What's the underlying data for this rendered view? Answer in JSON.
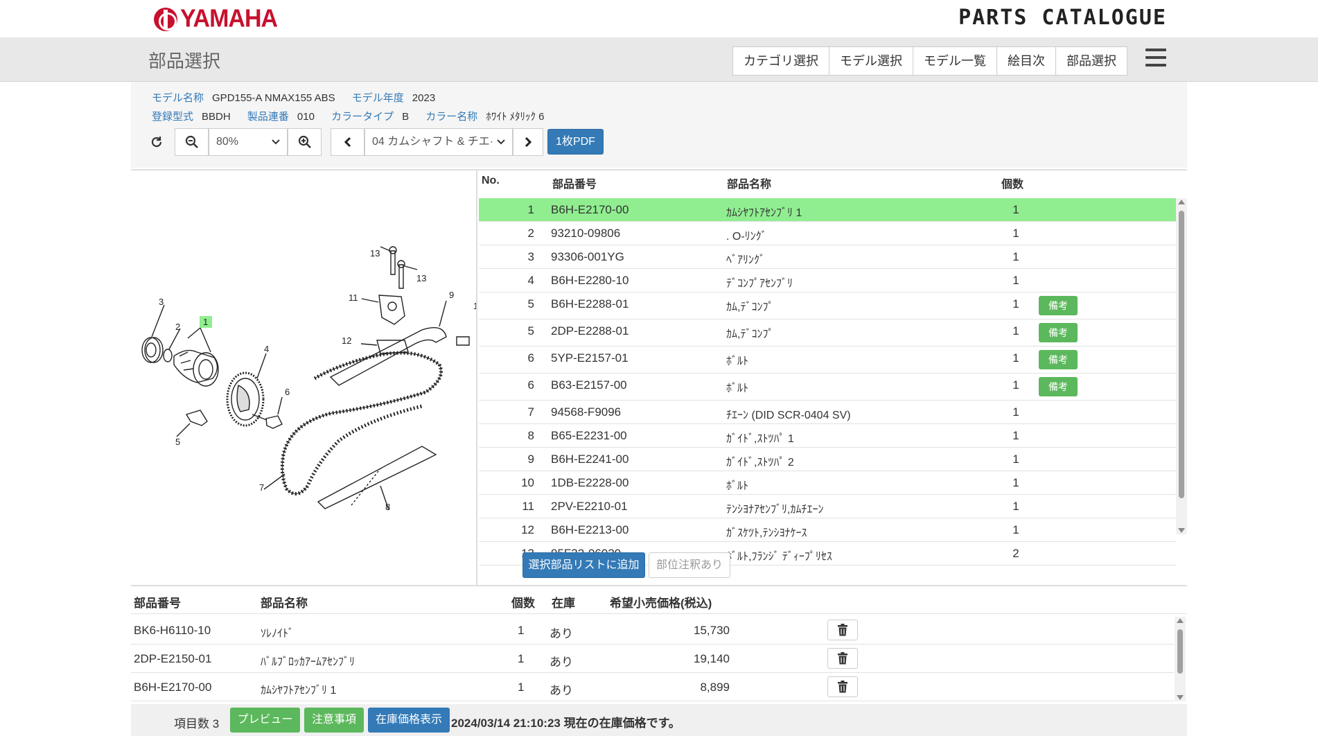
{
  "brand": {
    "logo_text": "YAMAHA",
    "catalogue_text": "PARTS CATALOGUE"
  },
  "header": {
    "title": "部品選択",
    "tabs": [
      "カテゴリ選択",
      "モデル選択",
      "モデル一覧",
      "絵目次",
      "部品選択"
    ]
  },
  "model": {
    "name_label": "モデル名称",
    "name_value": "GPD155-A NMAX155 ABS",
    "year_label": "モデル年度",
    "year_value": "2023",
    "type_label": "登録型式",
    "type_value": "BBDH",
    "serial_label": "製品連番",
    "serial_value": "010",
    "color_type_label": "カラータイプ",
    "color_type_value": "B",
    "color_name_label": "カラー名称",
    "color_name_value": "ﾎﾜｲﾄ ﾒﾀﾘｯｸ 6"
  },
  "toolbar": {
    "zoom_value": "80%",
    "figure_value": "04 カムシャフト & チエ·",
    "pdf_label": "1枚PDF"
  },
  "diagram_labels": [
    "1",
    "2",
    "3",
    "4",
    "5",
    "6",
    "7",
    "8",
    "9",
    "11",
    "12",
    "13",
    "13",
    "1"
  ],
  "parts_table": {
    "headers": {
      "no": "No.",
      "part_no": "部品番号",
      "name": "部品名称",
      "qty": "個数"
    },
    "note_label": "備考",
    "rows": [
      {
        "no": "1",
        "part_no": "B6H-E2170-00",
        "name": "ｶﾑｼﾔﾌﾄｱｾﾝﾌﾞﾘ 1",
        "qty": "1",
        "note": false,
        "selected": true
      },
      {
        "no": "2",
        "part_no": "93210-09806",
        "name": ". O-ﾘﾝｸﾞ",
        "qty": "1",
        "note": false
      },
      {
        "no": "3",
        "part_no": "93306-001YG",
        "name": "ﾍﾞｱﾘﾝｸﾞ",
        "qty": "1",
        "note": false
      },
      {
        "no": "4",
        "part_no": "B6H-E2280-10",
        "name": "ﾃﾞｺﾝﾌﾟｱｾﾝﾌﾞﾘ",
        "qty": "1",
        "note": false
      },
      {
        "no": "5",
        "part_no": "B6H-E2288-01",
        "name": "ｶﾑ,ﾃﾞｺﾝﾌﾟ",
        "qty": "1",
        "note": true
      },
      {
        "no": "5",
        "part_no": "2DP-E2288-01",
        "name": "ｶﾑ,ﾃﾞｺﾝﾌﾟ",
        "qty": "1",
        "note": true
      },
      {
        "no": "6",
        "part_no": "5YP-E2157-01",
        "name": "ﾎﾞﾙﾄ",
        "qty": "1",
        "note": true
      },
      {
        "no": "6",
        "part_no": "B63-E2157-00",
        "name": "ﾎﾞﾙﾄ",
        "qty": "1",
        "note": true
      },
      {
        "no": "7",
        "part_no": "94568-F9096",
        "name": "ﾁｴｰﾝ (DID SCR-0404 SV)",
        "qty": "1",
        "note": false
      },
      {
        "no": "8",
        "part_no": "B65-E2231-00",
        "name": "ｶﾞｲﾄﾞ,ｽﾄﾂﾊﾟ 1",
        "qty": "1",
        "note": false
      },
      {
        "no": "9",
        "part_no": "B6H-E2241-00",
        "name": "ｶﾞｲﾄﾞ,ｽﾄﾂﾊﾟ 2",
        "qty": "1",
        "note": false
      },
      {
        "no": "10",
        "part_no": "1DB-E2228-00",
        "name": "ﾎﾞﾙﾄ",
        "qty": "1",
        "note": false
      },
      {
        "no": "11",
        "part_no": "2PV-E2210-01",
        "name": "ﾃﾝｼﾖﾅｱｾﾝﾌﾞﾘ,ｶﾑﾁｴｰﾝ",
        "qty": "1",
        "note": false
      },
      {
        "no": "12",
        "part_no": "B6H-E2213-00",
        "name": "ｶﾞｽｹﾂﾄ,ﾃﾝｼﾖﾅｹｰｽ",
        "qty": "1",
        "note": false
      },
      {
        "no": "13",
        "part_no": "95F32-06020",
        "name": "ﾎﾞﾙﾄ,ﾌﾗﾝｼﾞ ﾃﾞｨｰﾌﾟﾘｾｽ",
        "qty": "2",
        "note": false
      }
    ]
  },
  "actions": {
    "add_label": "選択部品リストに追加",
    "part_note_label": "部位注釈あり"
  },
  "selected_list": {
    "headers": {
      "part_no": "部品番号",
      "name": "部品名称",
      "qty": "個数",
      "stock": "在庫",
      "price": "希望小売価格(税込)"
    },
    "rows": [
      {
        "part_no": "BK6-H6110-10",
        "name": "ｿﾚﾉｲﾄﾞ",
        "qty": "1",
        "stock": "あり",
        "price": "15,730"
      },
      {
        "part_no": "2DP-E2150-01",
        "name": "ﾊﾞﾙﾌﾞﾛｯｶｱｰﾑｱｾﾝﾌﾞﾘ",
        "qty": "1",
        "stock": "あり",
        "price": "19,140"
      },
      {
        "part_no": "B6H-E2170-00",
        "name": "ｶﾑｼﾔﾌﾄｱｾﾝﾌﾞﾘ 1",
        "qty": "1",
        "stock": "あり",
        "price": "8,899"
      }
    ]
  },
  "footer": {
    "count_label": "項目数 3",
    "preview_label": "プレビュー",
    "notes_label": "注意事項",
    "stock_price_label": "在庫価格表示",
    "status_text": "2024/03/14 21:10:23 現在の在庫価格です。"
  },
  "colors": {
    "selected_row": "#90ee90",
    "primary": "#337ab7",
    "success": "#5cb85c",
    "brand_red": "#c8102e"
  }
}
